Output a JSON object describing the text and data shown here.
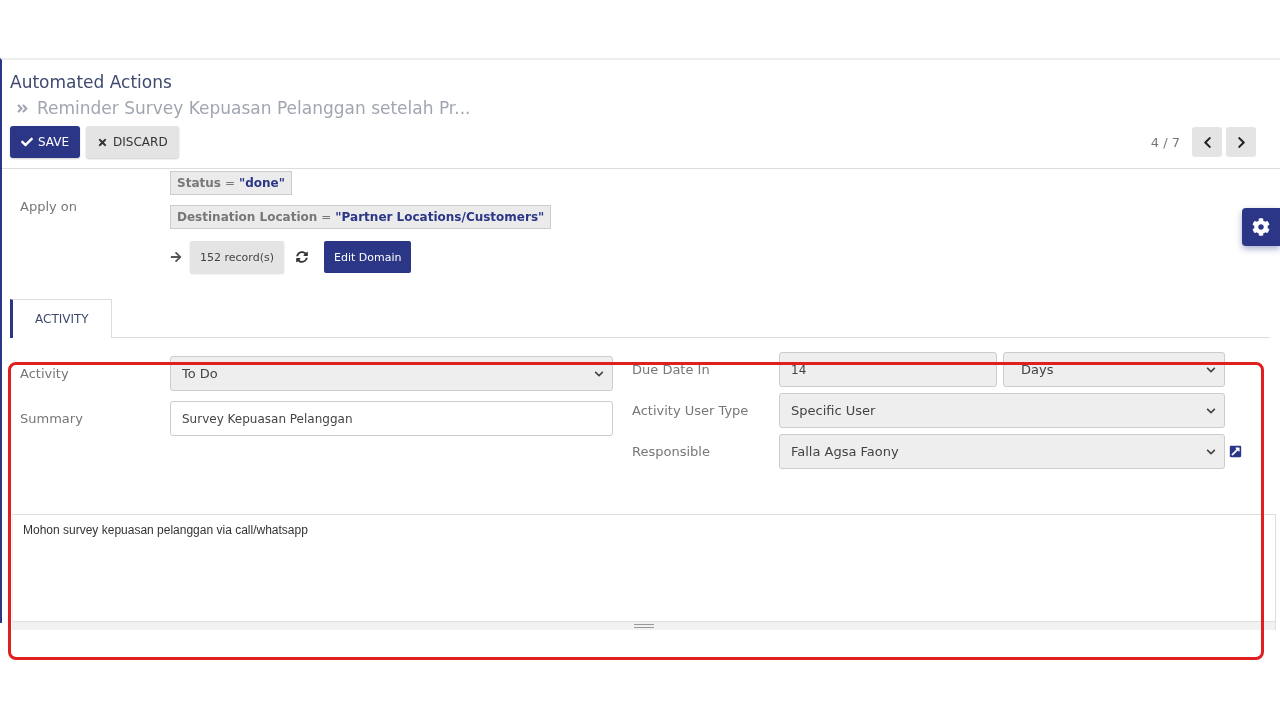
{
  "header": {
    "title": "Automated Actions",
    "breadcrumb": "Reminder Survey Kepuasan Pelanggan setelah Pr...",
    "pager": "4 / 7"
  },
  "buttons": [
    {
      "kind": "primary",
      "label": "SAVE"
    },
    {
      "kind": "secondary",
      "label": "DISCARD"
    }
  ],
  "apply_on": {
    "label": "Apply on",
    "conditions": [
      {
        "field": "Status",
        "operator": "=",
        "value": "\"done\""
      },
      {
        "field": "Destination Location",
        "operator": "=",
        "value": "\"Partner Locations/Customers\""
      }
    ],
    "records": "152 record(s)",
    "edit_button": "Edit Domain"
  },
  "tabs": [
    {
      "label": "ACTIVITY",
      "selected": true
    }
  ],
  "form": {
    "left": [
      {
        "label": "Activity",
        "kind": "select",
        "value": "To Do"
      },
      {
        "label": "Summary",
        "kind": "input",
        "value": "Survey Kepuasan Pelanggan"
      }
    ],
    "right": [
      {
        "label": "Due Date In",
        "kind": "duration",
        "value": "14",
        "unit": "Days"
      },
      {
        "label": "Activity User Type",
        "kind": "select",
        "value": "Specific User"
      },
      {
        "label": "Responsible",
        "kind": "relation",
        "value": "Falla Agsa Faony"
      }
    ],
    "note": "Mohon survey kepuasan pelanggan via call/whatsapp"
  }
}
